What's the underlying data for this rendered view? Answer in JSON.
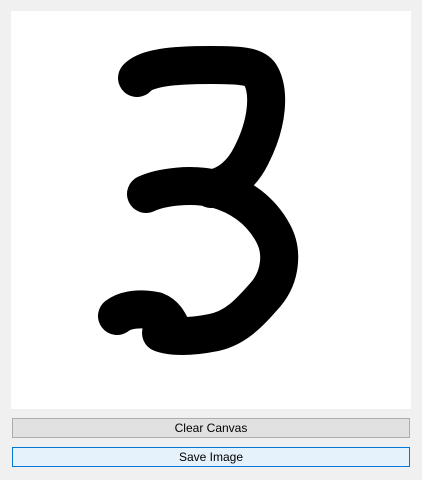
{
  "canvas": {
    "background": "#ffffff",
    "stroke_color": "#000000",
    "drawing": "handwritten digit 3"
  },
  "buttons": {
    "clear_label": "Clear Canvas",
    "save_label": "Save Image"
  },
  "colors": {
    "window_bg": "#f0f0f0",
    "button_bg": "#e1e1e1",
    "button_border": "#adadad",
    "focused_button_bg": "#e5f1fb",
    "focused_button_border": "#0078d7"
  }
}
